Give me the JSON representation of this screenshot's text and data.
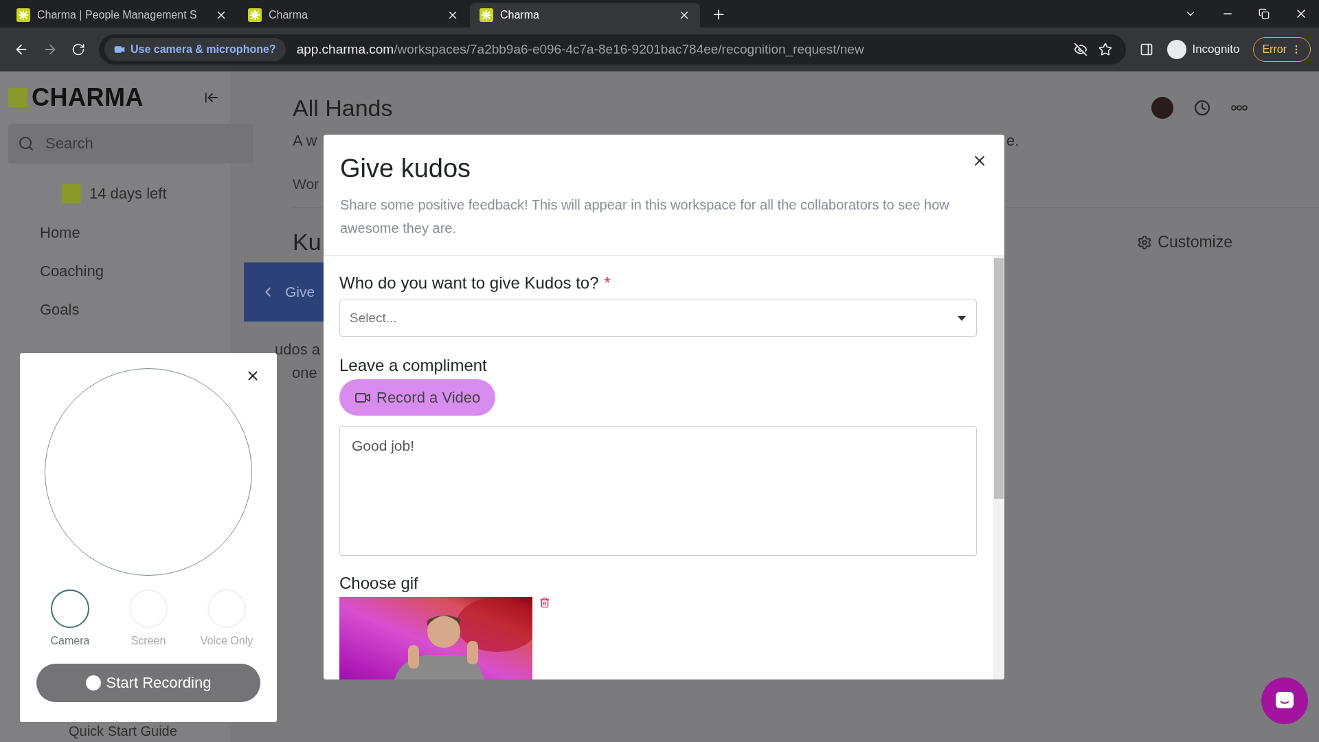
{
  "browser": {
    "tabs": [
      {
        "title": "Charma | People Management S",
        "selected": false
      },
      {
        "title": "Charma",
        "selected": false
      },
      {
        "title": "Charma",
        "selected": true
      }
    ],
    "permission_chip": "Use camera & microphone?",
    "url_host": "app.charma.com",
    "url_path": "/workspaces/7a2bb9a6-e096-4c7a-8e16-9201bac784ee/recognition_request/new",
    "profile": "Incognito",
    "error_button": "Error"
  },
  "sidebar": {
    "logo": "CHARMA",
    "search": {
      "placeholder": "Search"
    },
    "trial": "14 days left",
    "items": [
      {
        "label": "Home"
      },
      {
        "label": "Coaching"
      },
      {
        "label": "Goals"
      }
    ],
    "footer_link": "Quick Start Guide"
  },
  "page": {
    "title": "All Hands",
    "description": "A w",
    "description_tail": "e.",
    "tab": "Wor",
    "section_title": "Ku",
    "banner": "Give",
    "body_lines": [
      "udos a",
      "one"
    ],
    "customize": "Customize"
  },
  "modal": {
    "title": "Give kudos",
    "subtitle": "Share some positive feedback! This will appear in this workspace for all the collaborators to see how awesome they are.",
    "recipient_label": "Who do you want to give Kudos to?",
    "required_mark": "*",
    "recipient_select": {
      "placeholder": "Select..."
    },
    "compliment_label": "Leave a compliment",
    "record_button": "Record a Video",
    "compliment_text": "Good job!",
    "gif_label": "Choose gif"
  },
  "recorder": {
    "modes": [
      {
        "label": "Camera",
        "selected": true
      },
      {
        "label": "Screen",
        "selected": false
      },
      {
        "label": "Voice Only",
        "selected": false
      }
    ],
    "start_button": "Start Recording"
  }
}
